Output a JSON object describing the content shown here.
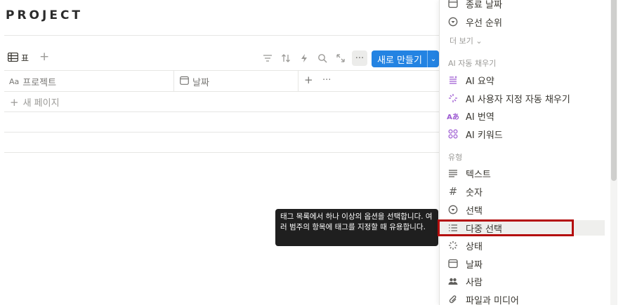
{
  "page": {
    "title": "PROJECT"
  },
  "viewbar": {
    "view_tab_label": "표",
    "new_button_label": "새로 만들기"
  },
  "table": {
    "columns": [
      {
        "type_prefix": "Aa",
        "label": "프로젝트"
      },
      {
        "label": "날짜"
      }
    ],
    "new_page_label": "새 페이지"
  },
  "tooltip": {
    "text": "태그 목록에서 하나 이상의 옵션을 선택합니다. 여러 범주의 항목에 태그를 지정할 때 유용합니다."
  },
  "menu": {
    "top_items": [
      {
        "label": "종료 날짜",
        "icon": "calendar-icon"
      },
      {
        "label": "우선 순위",
        "icon": "select-circle-icon"
      }
    ],
    "more_label": "더 보기",
    "ai_section_label": "AI 자동 채우기",
    "ai_items": [
      {
        "label": "AI 요약",
        "icon": "ai-summary-icon"
      },
      {
        "label": "AI 사용자 지정 자동 채우기",
        "icon": "ai-sparkle-icon"
      },
      {
        "label": "AI 번역",
        "icon": "ai-translate-icon"
      },
      {
        "label": "AI 키워드",
        "icon": "ai-keyword-icon"
      }
    ],
    "type_section_label": "유형",
    "type_items": [
      {
        "label": "텍스트",
        "icon": "text-lines-icon"
      },
      {
        "label": "숫자",
        "icon": "hash-icon"
      },
      {
        "label": "선택",
        "icon": "select-circle-icon"
      },
      {
        "label": "다중 선택",
        "icon": "multi-select-list-icon"
      },
      {
        "label": "상태",
        "icon": "status-spinner-icon"
      },
      {
        "label": "날짜",
        "icon": "calendar-icon"
      },
      {
        "label": "사람",
        "icon": "people-icon"
      },
      {
        "label": "파일과 미디어",
        "icon": "paperclip-icon"
      }
    ]
  },
  "colors": {
    "accent": "#2383e2",
    "highlight_border": "#b40d0d",
    "ai_purple": "#9d5bd2"
  }
}
